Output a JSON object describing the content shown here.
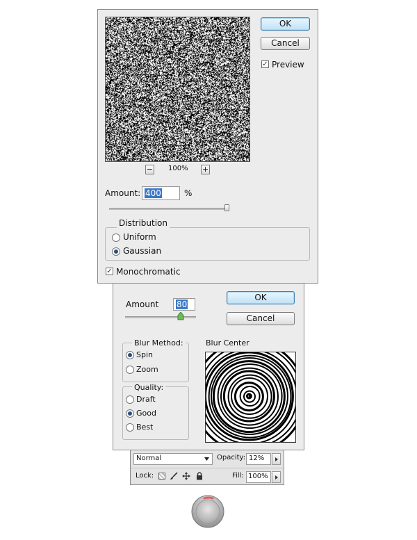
{
  "add_noise": {
    "ok_label": "OK",
    "cancel_label": "Cancel",
    "preview_label": "Preview",
    "preview_checked": true,
    "zoom_minus": "−",
    "zoom_level": "100%",
    "zoom_plus": "+",
    "amount_label": "Amount:",
    "amount_value": "400",
    "amount_unit": "%",
    "distribution_label": "Distribution",
    "uniform_label": "Uniform",
    "gaussian_label": "Gaussian",
    "selected_distribution": "Gaussian",
    "monochromatic_label": "Monochromatic",
    "monochromatic_checked": true
  },
  "radial_blur": {
    "amount_label": "Amount",
    "amount_value": "80",
    "ok_label": "OK",
    "cancel_label": "Cancel",
    "blur_method_label": "Blur Method:",
    "spin_label": "Spin",
    "zoom_label": "Zoom",
    "selected_method": "Spin",
    "quality_label": "Quality:",
    "draft_label": "Draft",
    "good_label": "Good",
    "best_label": "Best",
    "selected_quality": "Good",
    "blur_center_label": "Blur Center"
  },
  "layers": {
    "blend_mode": "Normal",
    "opacity_label": "Opacity:",
    "opacity_value": "12%",
    "lock_label": "Lock:",
    "fill_label": "Fill:",
    "fill_value": "100%"
  },
  "colors": {
    "accent": "#3a78c8",
    "dialog_bg": "#ececec",
    "knob_indicator": "#e06060"
  }
}
